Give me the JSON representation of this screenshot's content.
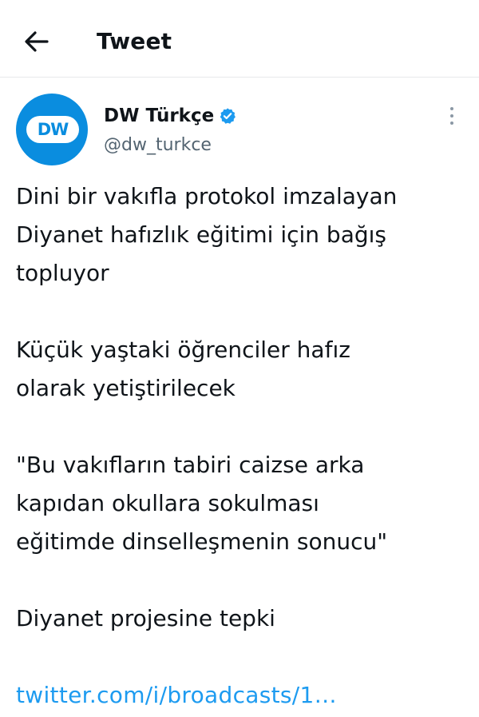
{
  "header": {
    "title": "Tweet"
  },
  "author": {
    "display_name": "DW Türkçe",
    "handle": "@dw_turkce",
    "avatar_text": "DW",
    "verified": true
  },
  "tweet": {
    "paragraph_1": "Dini bir vakıfla protokol imzalayan\nDiyanet hafızlık eğitimi için bağış\ntopluyor",
    "paragraph_2": "Küçük yaştaki öğrenciler hafız\nolarak yetiştirilecek",
    "paragraph_3": "\"Bu vakıfların tabiri caizse arka\nkapıdan okullara sokulması\neğitimde dinselleşmenin sonucu\"",
    "paragraph_4": "Diyanet projesine tepki",
    "link": "twitter.com/i/broadcasts/1…"
  },
  "colors": {
    "link": "#1d9bf0",
    "verified": "#1d9bf0",
    "avatar_bg": "#0a8ddf",
    "secondary_text": "#536471"
  },
  "icons": {
    "back": "arrow-left-icon",
    "verified": "verified-badge-icon",
    "more": "more-vertical-icon"
  }
}
